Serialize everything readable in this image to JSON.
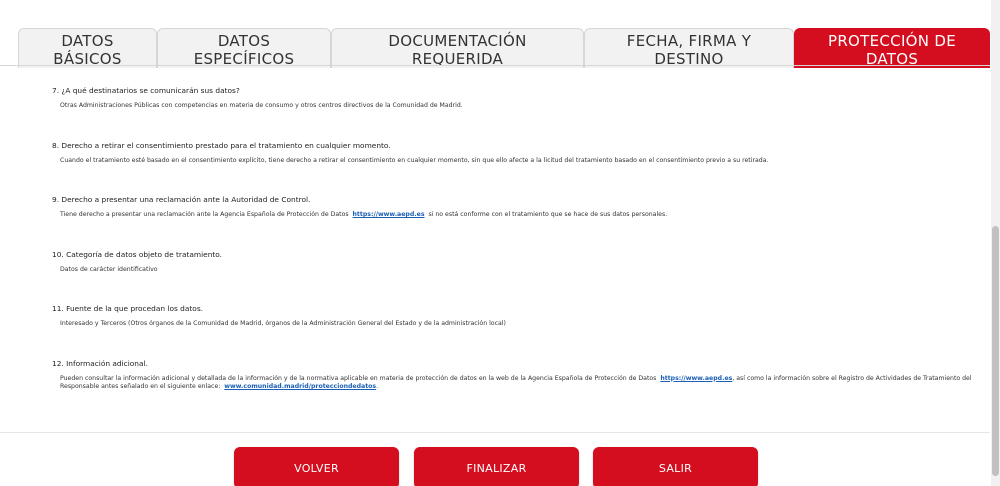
{
  "tabs": [
    {
      "line1": "DATOS",
      "line2": "BÁSICOS",
      "active": false
    },
    {
      "line1": "DATOS",
      "line2": "ESPECÍFICOS",
      "active": false
    },
    {
      "line1": "DOCUMENTACIÓN",
      "line2": "REQUERIDA",
      "active": false
    },
    {
      "line1": "FECHA, FIRMA Y",
      "line2": "DESTINO",
      "active": false
    },
    {
      "line1": "PROTECCIÓN DE",
      "line2": "DATOS",
      "active": true
    }
  ],
  "sections": [
    {
      "title": "7. ¿A qué destinatarios se comunicarán sus datos?",
      "body": "Otras Administraciones Públicas con competencias en materia de consumo y otros centros directivos de la Comunidad de Madrid."
    },
    {
      "title": "8. Derecho a retirar el consentimiento prestado para el tratamiento en cualquier momento.",
      "body": "Cuando el tratamiento esté basado en el consentimiento explícito, tiene derecho a retirar el consentimiento en cualquier momento, sin que ello afecte a la licitud del tratamiento basado en el consentimiento previo a su retirada."
    },
    {
      "title": "9. Derecho a presentar una reclamación ante la Autoridad de Control.",
      "body_before": "Tiene derecho a presentar una reclamación ante la Agencia Española de Protección de Datos",
      "link": "https://www.aepd.es",
      "body_after": "si no está conforme con el tratamiento que se hace de sus datos personales."
    },
    {
      "title": "10. Categoría de datos objeto de tratamiento.",
      "body": "Datos de carácter identificativo"
    },
    {
      "title": "11. Fuente de la que procedan los datos.",
      "body": "Interesado y Terceros (Otros órganos de la Comunidad de Madrid, órganos de la Administración General del Estado y de la administración local)"
    },
    {
      "title": "12. Información adicional.",
      "body_before": "Pueden consultar la información adicional y detallada de la información y de la normativa aplicable en materia de protección de datos en la web de la Agencia Española de Protección de Datos",
      "link1": "https://www.aepd.es",
      "body_middle": ", así como la información sobre el Registro de Actividades de Tratamiento del Responsable antes señalado en el siguiente enlace:",
      "link2": "www.comunidad.madrid/protecciondedatos",
      "body_after": "."
    }
  ],
  "buttons": {
    "back_label": "VOLVER",
    "finish_label": "FINALIZAR",
    "exit_label": "SALIR"
  },
  "colors": {
    "accent": "#d40d1f",
    "link": "#1a5fb4"
  }
}
